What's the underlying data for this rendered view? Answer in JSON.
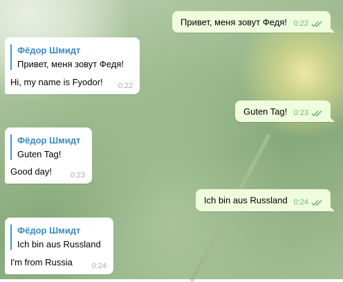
{
  "messages": [
    {
      "type": "outgoing",
      "text": "Привет, меня зовут Федя!",
      "time": "0:22"
    },
    {
      "type": "incoming",
      "reply_name": "Фёдор Шмидт",
      "reply_text": "Привет, меня зовут Федя!",
      "text": "Hi, my name is Fyodor!",
      "time": "0:22"
    },
    {
      "type": "outgoing",
      "text": "Guten Tag!",
      "time": "0:23"
    },
    {
      "type": "incoming",
      "reply_name": "Фёдор Шмидт",
      "reply_text": "Guten Tag!",
      "text": "Good day!",
      "time": "0:23"
    },
    {
      "type": "outgoing",
      "text": "Ich bin aus Russland",
      "time": "0:24"
    },
    {
      "type": "incoming",
      "reply_name": "Фёдор Шмидт",
      "reply_text": "Ich bin aus Russland",
      "text": "I'm from Russia",
      "time": "0:24"
    }
  ],
  "colors": {
    "outgoing_bubble": "#effdde",
    "incoming_bubble": "#ffffff",
    "reply_name": "#3a8ac4",
    "read_check": "#6cba6a",
    "timestamp_incoming": "#a0acb6"
  },
  "icons": {
    "read_status": "double-check-icon"
  }
}
